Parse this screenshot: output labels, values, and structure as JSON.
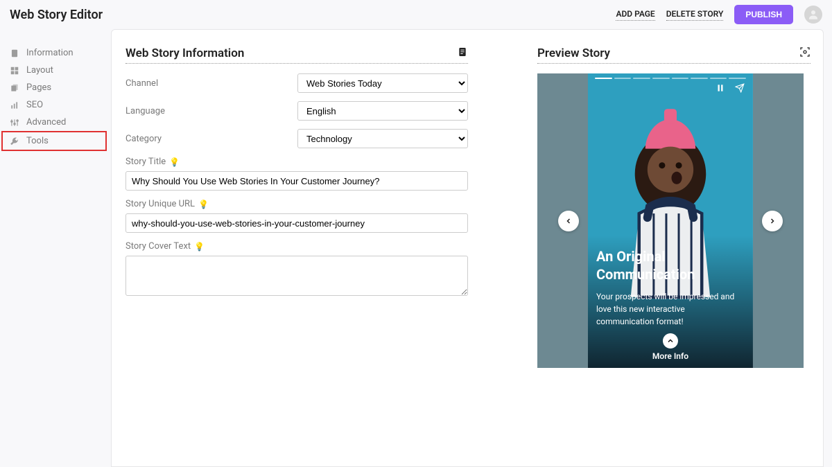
{
  "header": {
    "title": "Web Story Editor",
    "add_page": "ADD PAGE",
    "delete_story": "DELETE STORY",
    "publish": "PUBLISH"
  },
  "sidebar": {
    "items": [
      {
        "label": "Information",
        "icon": "document"
      },
      {
        "label": "Layout",
        "icon": "grid"
      },
      {
        "label": "Pages",
        "icon": "stack"
      },
      {
        "label": "SEO",
        "icon": "chart"
      },
      {
        "label": "Advanced",
        "icon": "sliders"
      },
      {
        "label": "Tools",
        "icon": "wrench"
      }
    ]
  },
  "form": {
    "section_title": "Web Story Information",
    "channel_label": "Channel",
    "channel_value": "Web Stories Today",
    "language_label": "Language",
    "language_value": "English",
    "category_label": "Category",
    "category_value": "Technology",
    "title_label": "Story Title",
    "title_value": "Why Should You Use Web Stories In Your Customer Journey?",
    "url_label": "Story Unique URL",
    "url_value": "why-should-you-use-web-stories-in-your-customer-journey",
    "cover_label": "Story Cover Text",
    "cover_value": ""
  },
  "preview": {
    "section_title": "Preview Story",
    "heading": "An Original Communication",
    "body": "Your prospects will be impressed and love this new interactive communication format!",
    "more_info": "More Info"
  }
}
